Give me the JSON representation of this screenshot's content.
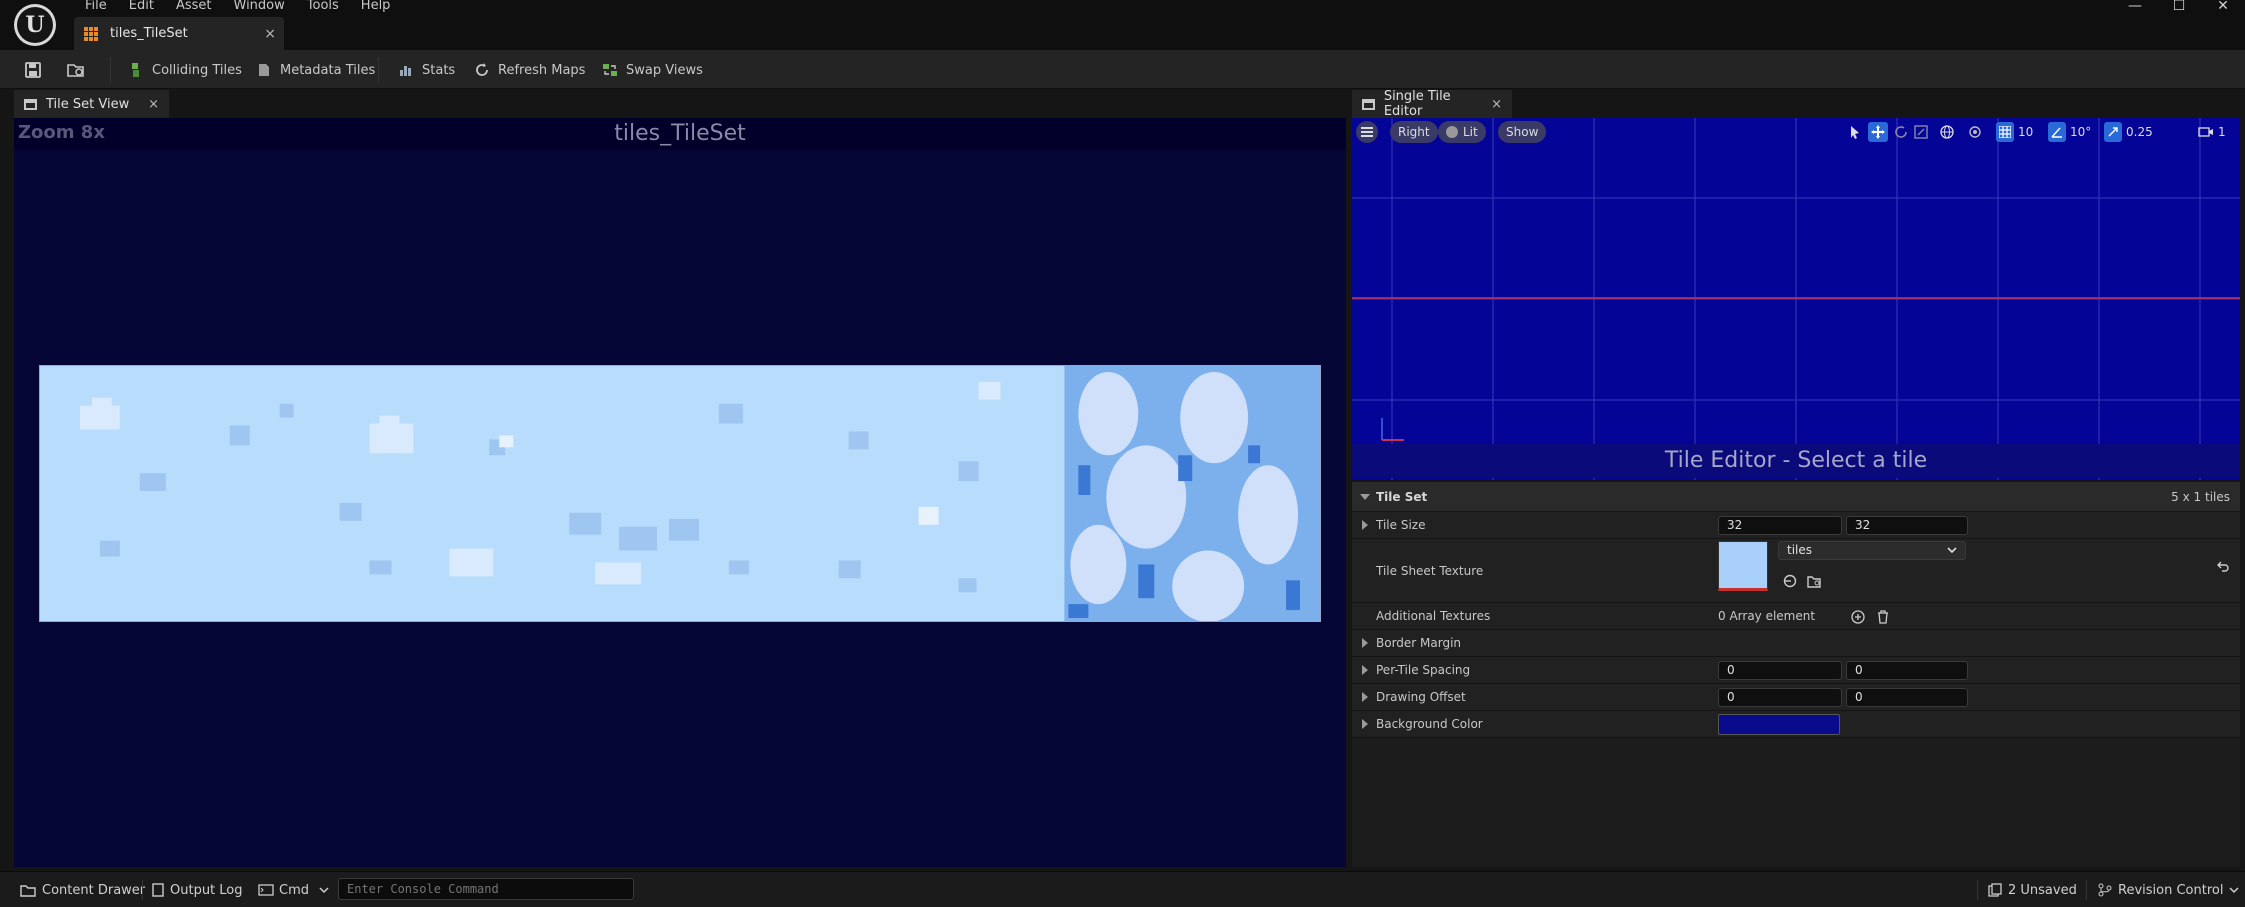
{
  "menu": [
    "File",
    "Edit",
    "Asset",
    "Window",
    "Tools",
    "Help"
  ],
  "doc_tab": {
    "label": "tiles_TileSet",
    "close": "×"
  },
  "window_controls": {
    "minimize": "—",
    "maximize": "☐",
    "close": "✕"
  },
  "toolbar": {
    "colliding_tiles": "Colliding Tiles",
    "metadata_tiles": "Metadata Tiles",
    "stats": "Stats",
    "refresh_maps": "Refresh Maps",
    "swap_views": "Swap Views"
  },
  "left_tab": {
    "label": "Tile Set View",
    "close": "×"
  },
  "right_tab": {
    "label": "Single Tile Editor",
    "close": "×"
  },
  "tile_view": {
    "zoom": "Zoom 8x",
    "title": "tiles_TileSet"
  },
  "viewport": {
    "view_mode": "Right",
    "lit": "Lit",
    "show": "Show",
    "grid_snap": "10",
    "rot_snap": "10°",
    "scale_snap": "0.25",
    "camera_speed": "1",
    "message": "Tile Editor - Select a tile"
  },
  "details": {
    "section": "Tile Set",
    "tile_count": "5 x 1 tiles",
    "rows": {
      "tile_size": {
        "label": "Tile Size",
        "x": "32",
        "y": "32"
      },
      "tile_sheet_texture": {
        "label": "Tile Sheet Texture",
        "value": "tiles"
      },
      "additional_textures": {
        "label": "Additional Textures",
        "value": "0 Array element"
      },
      "border_margin": {
        "label": "Border Margin"
      },
      "per_tile_spacing": {
        "label": "Per-Tile Spacing",
        "x": "0",
        "y": "0"
      },
      "drawing_offset": {
        "label": "Drawing Offset",
        "x": "0",
        "y": "0"
      },
      "background_color": {
        "label": "Background Color",
        "color": "#0a0a8c"
      }
    }
  },
  "statusbar": {
    "content_drawer": "Content Drawer",
    "output_log": "Output Log",
    "cmd": "Cmd",
    "console_placeholder": "Enter Console Command",
    "unsaved": "2 Unsaved",
    "revision_control": "Revision Control"
  }
}
